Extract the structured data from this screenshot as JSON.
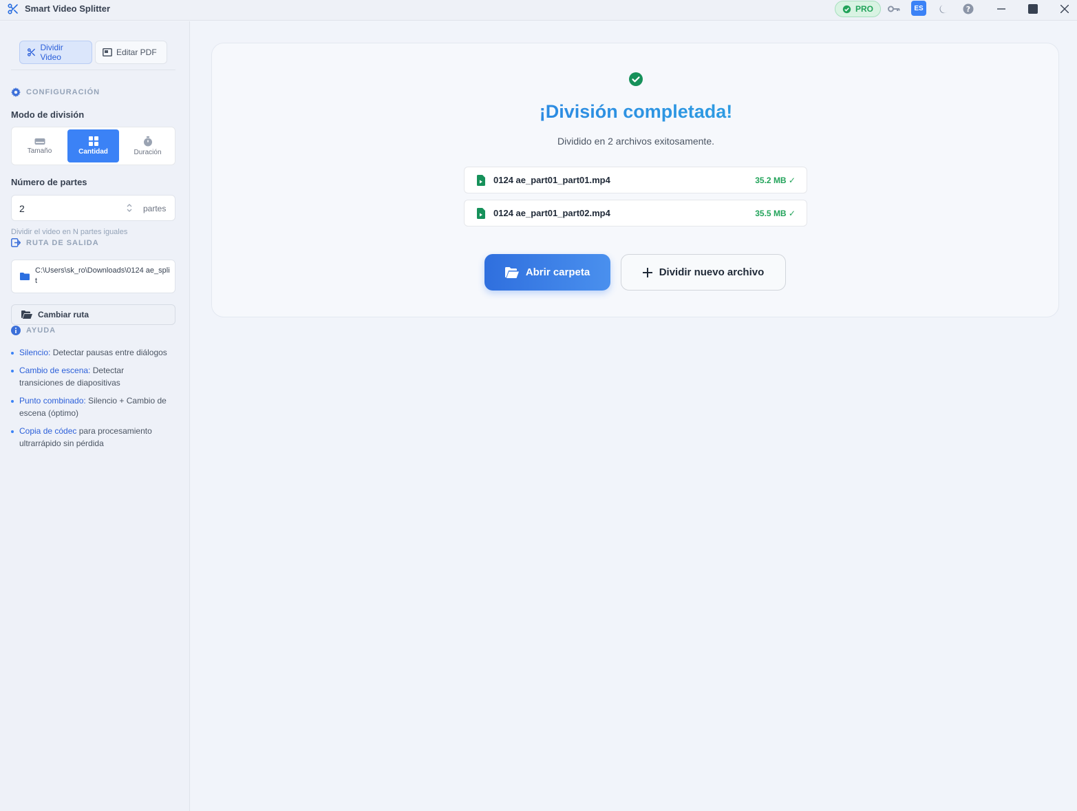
{
  "titlebar": {
    "app_title": "Smart Video Splitter",
    "pro_label": "PRO",
    "lang_label": "ES",
    "icons": [
      "key-icon",
      "moon-icon",
      "help-icon",
      "minimize-icon",
      "maximize-icon",
      "close-icon"
    ]
  },
  "sidebar": {
    "tabs": [
      {
        "label": "Dividir Video",
        "icon": "scissors-icon",
        "active": true
      },
      {
        "label": "Editar PDF",
        "icon": "pdf-icon",
        "active": false
      }
    ],
    "config_heading": "CONFIGURACIÓN",
    "mode_label": "Modo de división",
    "modes": [
      {
        "label": "Tamaño",
        "icon": "drive-icon",
        "active": false
      },
      {
        "label": "Cantidad",
        "icon": "grid-icon",
        "active": true
      },
      {
        "label": "Duración",
        "icon": "stopwatch-icon",
        "active": false
      }
    ],
    "parts_label": "Número de partes",
    "parts_value": "2",
    "parts_unit": "partes",
    "parts_hint": "Dividir el video en N partes iguales",
    "output_heading": "RUTA DE SALIDA",
    "output_path": "C:\\Users\\sk_ro\\Downloads\\0124 ae_split",
    "change_path_label": "Cambiar ruta",
    "help_heading": "AYUDA",
    "help_items": [
      {
        "keyword": "Silencio:",
        "text": " Detectar pausas entre diálogos"
      },
      {
        "keyword": "Cambio de escena:",
        "text": " Detectar transiciones de diapositivas"
      },
      {
        "keyword": "Punto combinado:",
        "text": " Silencio + Cambio de escena (óptimo)"
      },
      {
        "keyword": "Copia de códec",
        "text": " para procesamiento ultrarrápido sin pérdida"
      }
    ]
  },
  "result": {
    "title": "¡División completada!",
    "subtitle": "Dividido en 2 archivos exitosamente.",
    "files": [
      {
        "name": "0124 ae_part01_part01.mp4",
        "size": "35.2 MB ✓"
      },
      {
        "name": "0124 ae_part01_part02.mp4",
        "size": "35.5 MB ✓"
      }
    ],
    "open_folder_label": "Abrir carpeta",
    "split_new_label": "Dividir nuevo archivo"
  },
  "colors": {
    "accent": "#3b82f6",
    "success": "#22a35a",
    "background": "#f1f4fa"
  }
}
